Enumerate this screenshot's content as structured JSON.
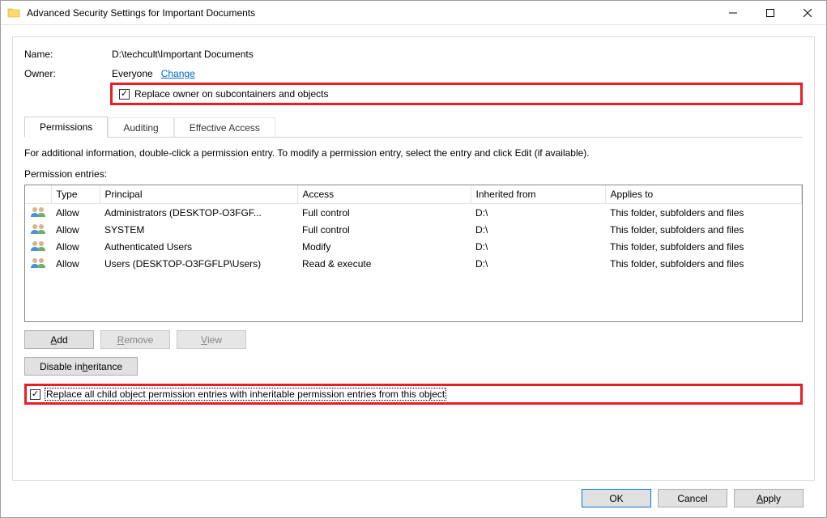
{
  "title": "Advanced Security Settings for Important Documents",
  "name_label": "Name:",
  "name_value": "D:\\techcult\\Important Documents",
  "owner_label": "Owner:",
  "owner_value": "Everyone",
  "owner_change": "Change",
  "replace_owner_label": "Replace owner on subcontainers and objects",
  "tabs": {
    "permissions": "Permissions",
    "auditing": "Auditing",
    "effective": "Effective Access"
  },
  "info_text": "For additional information, double-click a permission entry. To modify a permission entry, select the entry and click Edit (if available).",
  "entries_label": "Permission entries:",
  "columns": {
    "type": "Type",
    "principal": "Principal",
    "access": "Access",
    "inherited": "Inherited from",
    "applies": "Applies to"
  },
  "rows": [
    {
      "type": "Allow",
      "principal": "Administrators (DESKTOP-O3FGF...",
      "access": "Full control",
      "inherited": "D:\\",
      "applies": "This folder, subfolders and files"
    },
    {
      "type": "Allow",
      "principal": "SYSTEM",
      "access": "Full control",
      "inherited": "D:\\",
      "applies": "This folder, subfolders and files"
    },
    {
      "type": "Allow",
      "principal": "Authenticated Users",
      "access": "Modify",
      "inherited": "D:\\",
      "applies": "This folder, subfolders and files"
    },
    {
      "type": "Allow",
      "principal": "Users (DESKTOP-O3FGFLP\\Users)",
      "access": "Read & execute",
      "inherited": "D:\\",
      "applies": "This folder, subfolders and files"
    }
  ],
  "buttons": {
    "add": "Add",
    "remove": "Remove",
    "view": "View",
    "disable_inh": "Disable inheritance"
  },
  "replace_child_label": "Replace all child object permission entries with inheritable permission entries from this object",
  "footer": {
    "ok": "OK",
    "cancel": "Cancel",
    "apply": "Apply"
  }
}
